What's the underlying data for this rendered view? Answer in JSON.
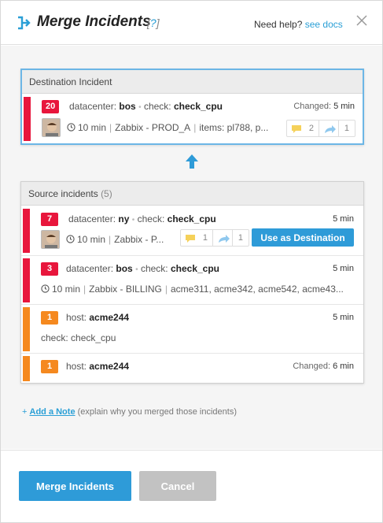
{
  "header": {
    "title": "Merge Incidents",
    "help_open": "[",
    "help_q": "?",
    "help_close": "]",
    "need_help": "Need help?",
    "see_docs": "see docs"
  },
  "destination": {
    "heading": "Destination Incident",
    "badge": "20",
    "label1": "datacenter:",
    "value1": "bos",
    "label2": "check:",
    "value2": "check_cpu",
    "changed_label": "Changed:",
    "changed_value": "5 min",
    "duration": "10 min",
    "source": "Zabbix - PROD_A",
    "items": "items: pl788, p...",
    "comments": "2",
    "forwards": "1"
  },
  "source": {
    "heading": "Source incidents",
    "count": "(5)",
    "rows": [
      {
        "badge": "7",
        "label1": "datacenter:",
        "value1": "ny",
        "label2": "check:",
        "value2": "check_cpu",
        "age": "5 min",
        "duration": "10 min",
        "src": "Zabbix - P...",
        "comments": "1",
        "forwards": "1",
        "action": "Use as Destination"
      },
      {
        "badge": "3",
        "label1": "datacenter:",
        "value1": "bos",
        "label2": "check:",
        "value2": "check_cpu",
        "age": "5 min",
        "duration": "10 min",
        "src": "Zabbix - BILLING",
        "hosts": "acme311, acme342, acme542, acme43..."
      },
      {
        "badge": "1",
        "label1": "host:",
        "value1": "acme244",
        "age": "5 min",
        "sub": "check: check_cpu"
      },
      {
        "badge": "1",
        "label1": "host:",
        "value1": "acme244",
        "changed_label": "Changed:",
        "changed_value": "6 min"
      }
    ]
  },
  "note": {
    "prefix": "+",
    "link": "Add a Note",
    "hint": "(explain why you merged those incidents)"
  },
  "footer": {
    "merge": "Merge Incidents",
    "cancel": "Cancel"
  },
  "colors": {
    "accent": "#2e9bd8",
    "critical": "#e8163c",
    "warning": "#f5891f"
  }
}
